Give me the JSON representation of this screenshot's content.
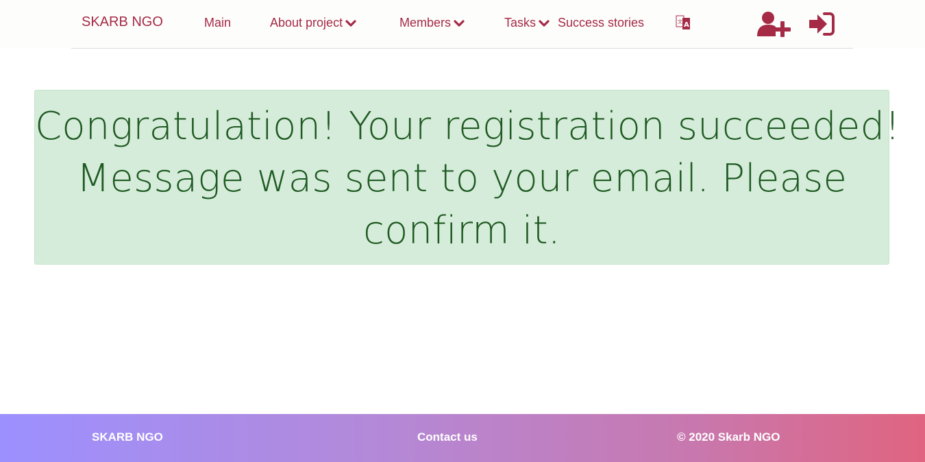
{
  "header": {
    "brand": "SKARB NGO",
    "nav": {
      "main": "Main",
      "about": "About project",
      "members": "Members",
      "tasks": "Tasks",
      "success": "Success stories"
    },
    "icons": {
      "translate": "translate-icon",
      "register": "user-plus-icon",
      "login": "sign-in-icon"
    },
    "accent_color": "#a52a46"
  },
  "alert": {
    "line1": "Congratulation! Your registration succeeded!",
    "line2": "Message was sent to your email. Please",
    "line3": "confirm it.",
    "background_color": "#d6ecda",
    "text_color": "#1e5a22"
  },
  "footer": {
    "brand": "SKARB NGO",
    "contact": "Contact us",
    "copyright": "© 2020 Skarb NGO",
    "gradient_colors": [
      "#9c90ff",
      "#b389d9",
      "#c878ae",
      "#e06480"
    ]
  }
}
